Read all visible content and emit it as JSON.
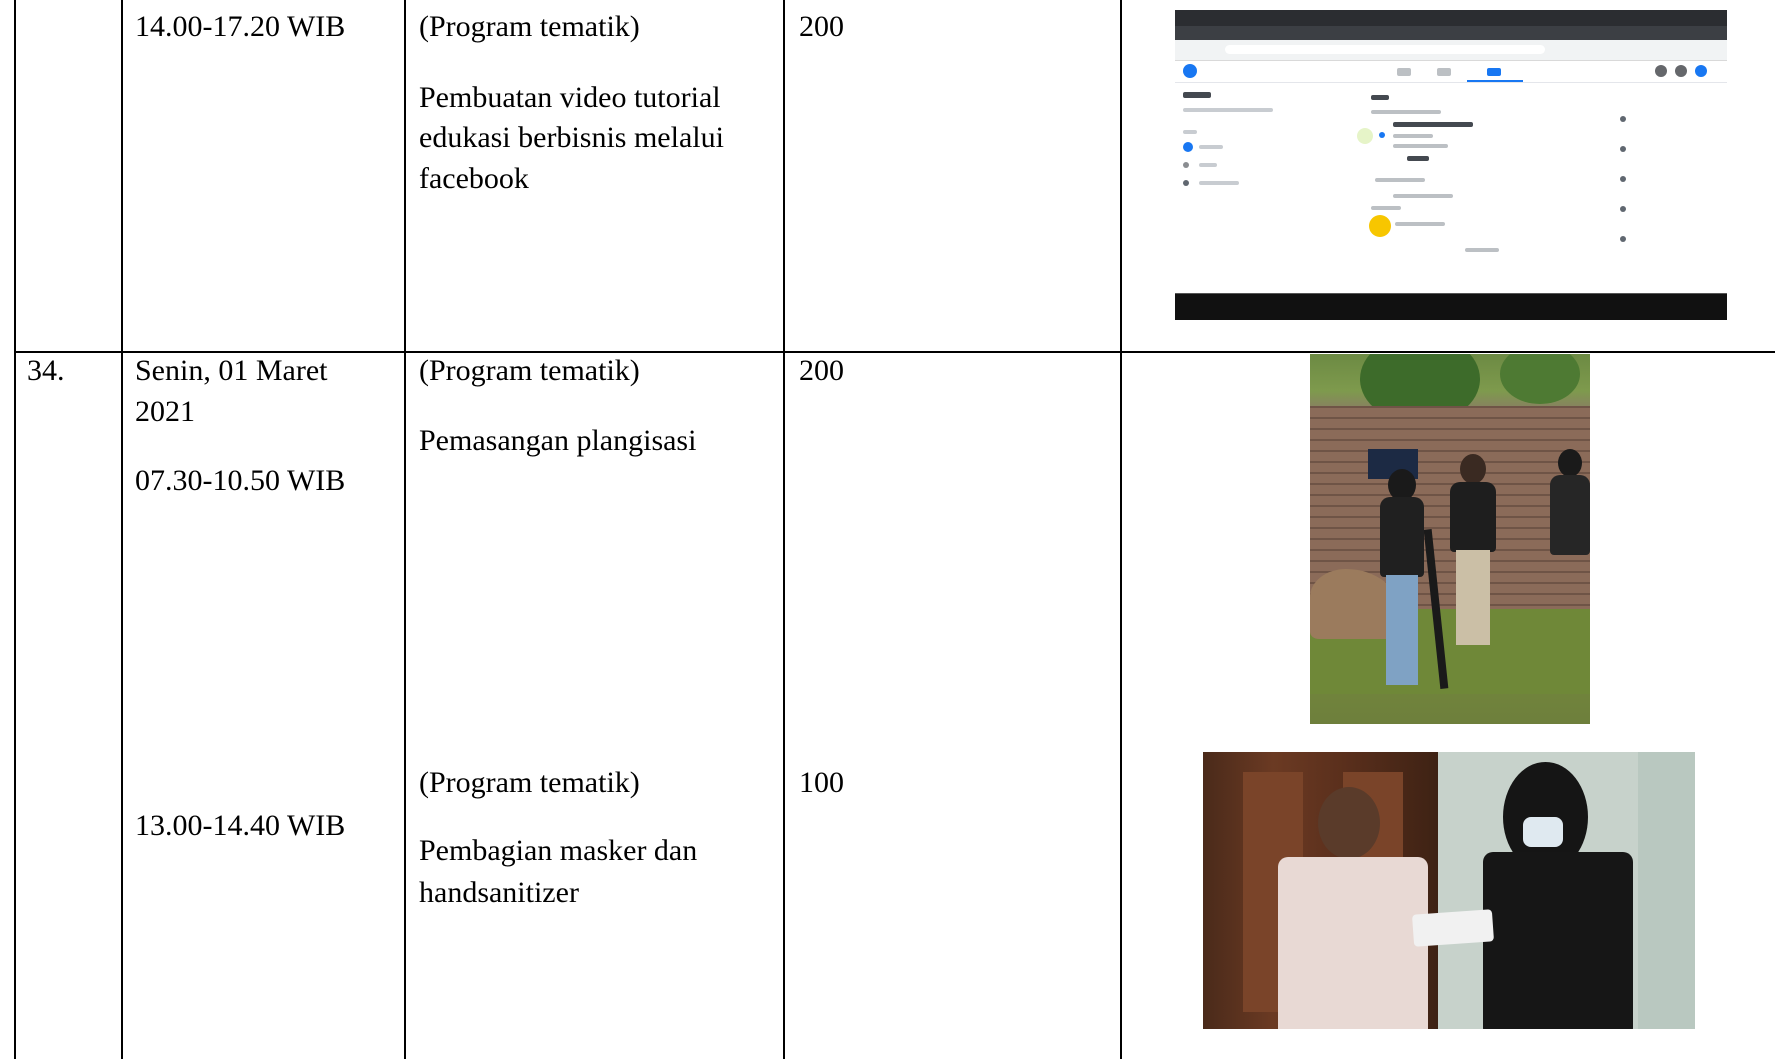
{
  "table": {
    "rows": [
      {
        "no": "",
        "time_lines": [
          "14.00-17.20 WIB"
        ],
        "activities": [
          {
            "program": "(Program tematik)",
            "desc_lines": [
              "Pembuatan video tutorial",
              "edukasi berbisnis melalui",
              "facebook"
            ],
            "value": "200"
          }
        ],
        "images": [
          "facebook-page-screenshot"
        ]
      },
      {
        "no": "34.",
        "time_lines": [
          "Senin, 01 Maret",
          "2021",
          "07.30-10.50 WIB",
          "13.00-14.40 WIB"
        ],
        "activities": [
          {
            "program": "(Program tematik)",
            "desc_lines": [
              "Pemasangan plangisasi"
            ],
            "value": "200"
          },
          {
            "program": "(Program tematik)",
            "desc_lines": [
              "Pembagian masker dan",
              "handsanitizer"
            ],
            "value": "100"
          }
        ],
        "images": [
          "photo-plangisasi",
          "photo-masker-handover"
        ]
      }
    ]
  },
  "colors": {
    "border": "#000000",
    "facebook_blue": "#1877f2",
    "wall_brick": "#8b6b59"
  }
}
